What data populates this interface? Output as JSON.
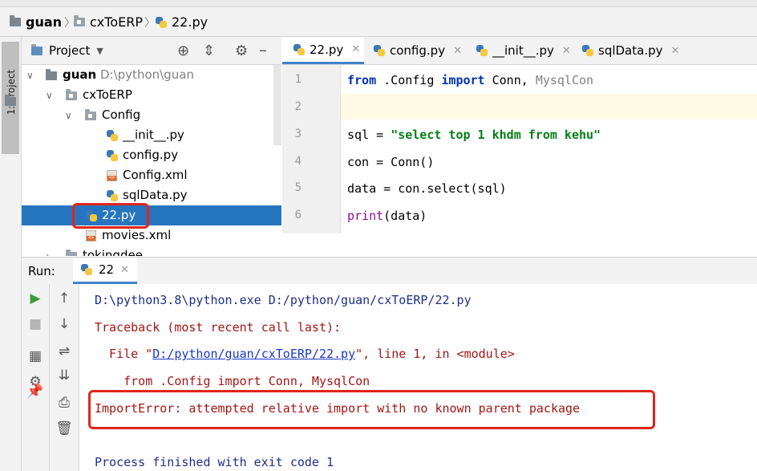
{
  "breadcrumb": [
    {
      "label": "guan",
      "icon": "folder-icon"
    },
    {
      "label": "cxToERP",
      "icon": "package-folder-icon"
    },
    {
      "label": "22.py",
      "icon": "python-file-icon"
    }
  ],
  "sidebar": {
    "project_tab": "1: Project"
  },
  "project_panel": {
    "title": "Project",
    "tree": [
      {
        "label": "guan",
        "path": "D:\\python\\guan",
        "bold": true
      },
      {
        "label": "cxToERP"
      },
      {
        "label": "Config"
      },
      {
        "label": "__init__.py"
      },
      {
        "label": "config.py"
      },
      {
        "label": "Config.xml"
      },
      {
        "label": "sqlData.py"
      },
      {
        "label": "22.py",
        "selected": true
      },
      {
        "label": "movies.xml"
      },
      {
        "label": "tokingdee"
      }
    ]
  },
  "editor": {
    "tabs": [
      {
        "label": "22.py",
        "active": true
      },
      {
        "label": "config.py"
      },
      {
        "label": "__init__.py"
      },
      {
        "label": "sqlData.py"
      }
    ],
    "line_numbers": [
      "1",
      "2",
      "3",
      "4",
      "5",
      "6"
    ],
    "lines": {
      "l1_kw1": "from",
      "l1_mod": " .Config ",
      "l1_kw2": "import",
      "l1_names": " Conn, ",
      "l1_dim": "MysqlCon",
      "l3_a": "sql = ",
      "l3_str": "\"select top 1 khdm from kehu\"",
      "l4": "con = Conn()",
      "l5": "data = con.select(sql)",
      "l6_fn": "print",
      "l6_rest": "(data)"
    }
  },
  "run_panel": {
    "label": "Run:",
    "tab": "22",
    "output": {
      "cmd": "D:\\python3.8\\python.exe D:/python/guan/cxToERP/22.py",
      "traceback": "Traceback (most recent call last):",
      "file_pre": "  File \"",
      "file_link": "D:/python/guan/cxToERP/22.py",
      "file_post": "\", line 1, in <module>",
      "src": "    from .Config import Conn, MysqlCon",
      "error": "ImportError: attempted relative import with no known parent package",
      "finished": "Process finished with exit code 1"
    }
  },
  "colors": {
    "selection": "#2675bf",
    "highlight": "#e1251b",
    "keyword": "#0033b3",
    "string": "#067d17"
  }
}
